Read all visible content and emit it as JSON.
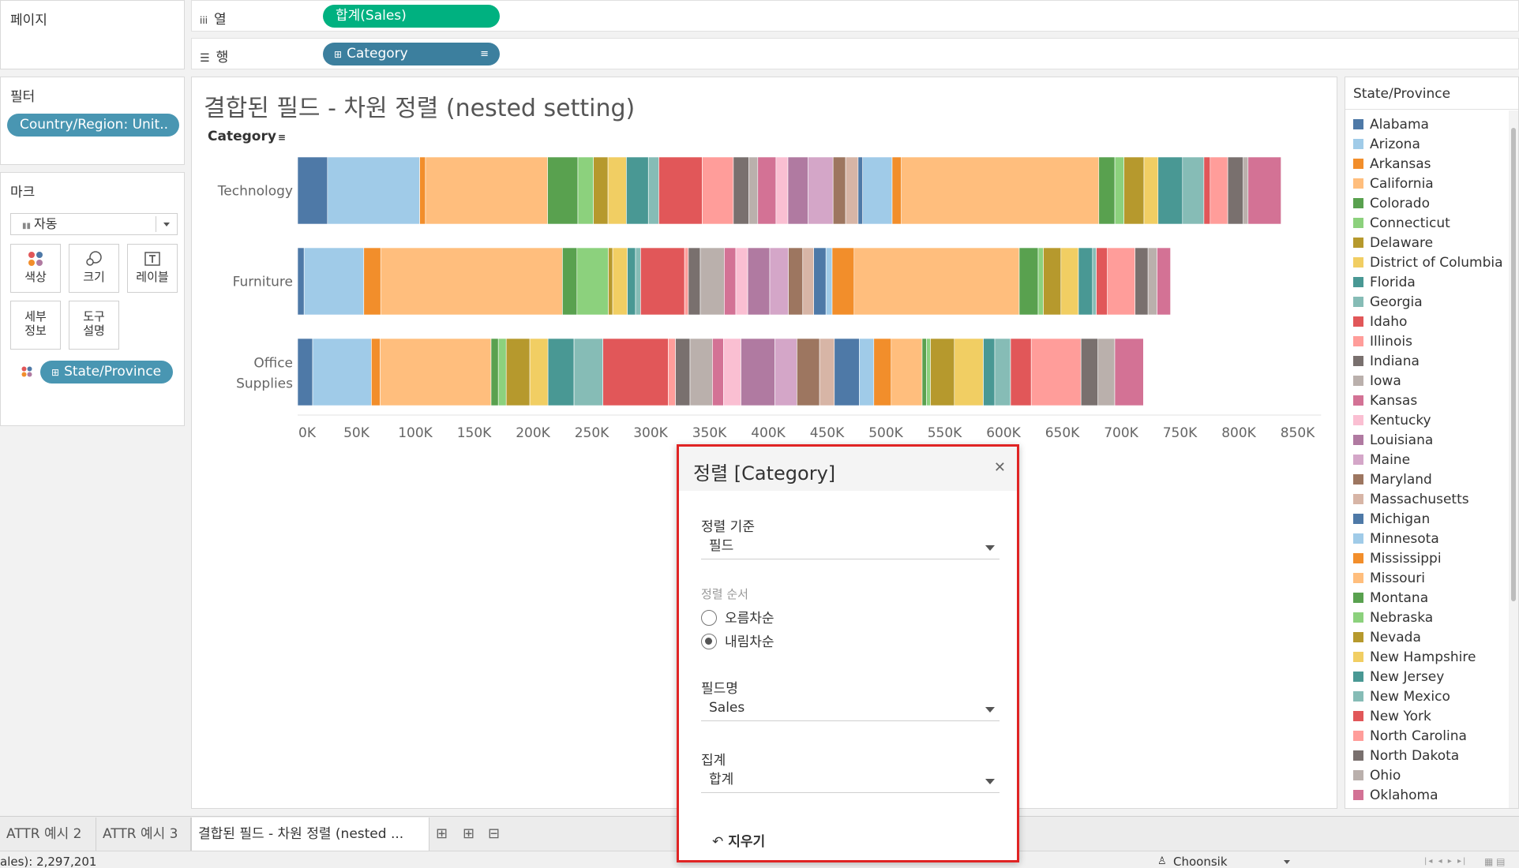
{
  "left_panel": {
    "pages_title": "페이지",
    "filters_title": "필터",
    "filter_pill": "Country/Region: Unit..",
    "marks_title": "마크",
    "mark_type": "자동",
    "mark_cards": [
      "색상",
      "크기",
      "레이블",
      "세부\n정보",
      "도구\n설명"
    ],
    "marks_pill": "State/Province"
  },
  "shelves": {
    "columns_label": "열",
    "columns_pill": "합계(Sales)",
    "rows_label": "행",
    "rows_pill": "Category"
  },
  "view": {
    "title": "결합된 필드 - 차원 정렬 (nested setting)",
    "row_header": "Category"
  },
  "chart_data": {
    "type": "bar",
    "orientation": "horizontal",
    "stacked": true,
    "categories": [
      "Technology",
      "Furniture",
      "Office Supplies"
    ],
    "totals": [
      836000,
      742000,
      719000
    ],
    "xlim": [
      0,
      870000
    ],
    "xticks": [
      "0K",
      "50K",
      "100K",
      "150K",
      "200K",
      "250K",
      "300K",
      "350K",
      "400K",
      "450K",
      "500K",
      "550K",
      "600K",
      "650K",
      "700K",
      "750K",
      "800K",
      "850K"
    ],
    "legend_title": "State/Province",
    "legend_position": "right",
    "grid": false
  },
  "legend": {
    "title": "State/Province",
    "items": [
      {
        "name": "Alabama",
        "color": "#4e79a7"
      },
      {
        "name": "Arizona",
        "color": "#a0cbe8"
      },
      {
        "name": "Arkansas",
        "color": "#f28e2b"
      },
      {
        "name": "California",
        "color": "#ffbe7d"
      },
      {
        "name": "Colorado",
        "color": "#59a14f"
      },
      {
        "name": "Connecticut",
        "color": "#8cd17d"
      },
      {
        "name": "Delaware",
        "color": "#b6992d"
      },
      {
        "name": "District of Columbia",
        "color": "#f1ce63"
      },
      {
        "name": "Florida",
        "color": "#499894"
      },
      {
        "name": "Georgia",
        "color": "#86bcb6"
      },
      {
        "name": "Idaho",
        "color": "#e15759"
      },
      {
        "name": "Illinois",
        "color": "#ff9d9a"
      },
      {
        "name": "Indiana",
        "color": "#79706e"
      },
      {
        "name": "Iowa",
        "color": "#bab0ac"
      },
      {
        "name": "Kansas",
        "color": "#d37295"
      },
      {
        "name": "Kentucky",
        "color": "#fabfd2"
      },
      {
        "name": "Louisiana",
        "color": "#b07aa1"
      },
      {
        "name": "Maine",
        "color": "#d4a6c8"
      },
      {
        "name": "Maryland",
        "color": "#9d7660"
      },
      {
        "name": "Massachusetts",
        "color": "#d7b5a6"
      },
      {
        "name": "Michigan",
        "color": "#4e79a7"
      },
      {
        "name": "Minnesota",
        "color": "#a0cbe8"
      },
      {
        "name": "Mississippi",
        "color": "#f28e2b"
      },
      {
        "name": "Missouri",
        "color": "#ffbe7d"
      },
      {
        "name": "Montana",
        "color": "#59a14f"
      },
      {
        "name": "Nebraska",
        "color": "#8cd17d"
      },
      {
        "name": "Nevada",
        "color": "#b6992d"
      },
      {
        "name": "New Hampshire",
        "color": "#f1ce63"
      },
      {
        "name": "New Jersey",
        "color": "#499894"
      },
      {
        "name": "New Mexico",
        "color": "#86bcb6"
      },
      {
        "name": "New York",
        "color": "#e15759"
      },
      {
        "name": "North Carolina",
        "color": "#ff9d9a"
      },
      {
        "name": "North Dakota",
        "color": "#79706e"
      },
      {
        "name": "Ohio",
        "color": "#bab0ac"
      },
      {
        "name": "Oklahoma",
        "color": "#d37295"
      }
    ]
  },
  "sort_dialog": {
    "title": "정렬 [Category]",
    "sort_by_label": "정렬 기준",
    "sort_by_value": "필드",
    "sort_order_label": "정렬 순서",
    "ascending": "오름차순",
    "descending": "내림차순",
    "selected_order": "descending",
    "field_name_label": "필드명",
    "field_name_value": "Sales",
    "aggregation_label": "집계",
    "aggregation_value": "합계",
    "clear_button": "지우기"
  },
  "tabs": [
    "ATTR 예시 2",
    "ATTR 예시 3",
    "결합된 필드 - 차원 정렬 (nested ..."
  ],
  "status_bar": {
    "summary": "ales): 2,297,201",
    "user": "Choonsik"
  }
}
